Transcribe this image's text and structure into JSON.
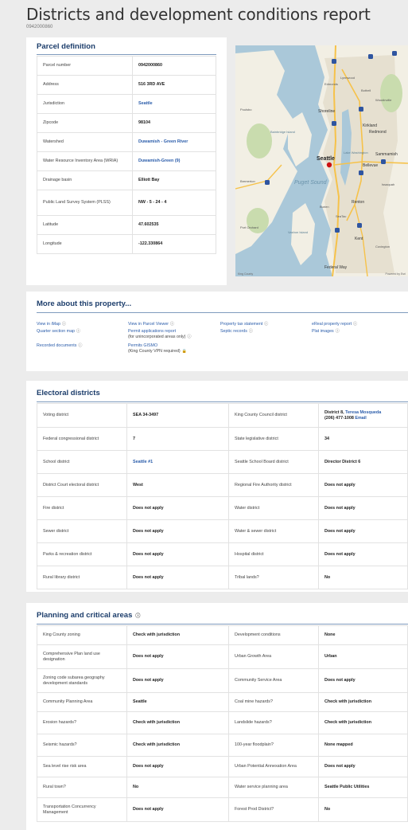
{
  "page": {
    "title": "Districts and development conditions report",
    "parcel_id": "0942000860"
  },
  "parcel": {
    "heading": "Parcel definition",
    "rows": [
      {
        "label": "Parcel number",
        "value": "0942000860",
        "label_link": false,
        "value_link": false
      },
      {
        "label": "Address",
        "value": "516 3RD AVE",
        "label_link": false,
        "value_link": false
      },
      {
        "label": "Jurisdiction",
        "value": "Seattle",
        "label_link": false,
        "value_link": true
      },
      {
        "label": "Zipcode",
        "value": "98104",
        "label_link": false,
        "value_link": false
      },
      {
        "label": "Watershed",
        "value": "Duwamish - Green River",
        "label_link": true,
        "value_link": true
      },
      {
        "label": "Water Resource Inventory Area (WRIA)",
        "value": "Duwamish-Green (9)",
        "label_link": true,
        "value_link": true
      },
      {
        "label": "Drainage basin",
        "value": "Elliott Bay",
        "label_link": false,
        "value_link": false
      },
      {
        "label": "Public Land Survey System (PLSS)",
        "value": "NW - 5 - 24 - 4",
        "label_link": false,
        "value_link": false
      },
      {
        "label": "Latitude",
        "value": "47.602535",
        "label_link": false,
        "value_link": false
      },
      {
        "label": "Longitude",
        "value": "-122.330864",
        "label_link": false,
        "value_link": false
      }
    ]
  },
  "map": {
    "labels": {
      "lynnwood": "Lynnwood",
      "edmonds": "Edmonds",
      "bothell": "Bothell",
      "woodinville": "Woodinville",
      "shoreline": "Shoreline",
      "kirkland": "Kirkland",
      "redmond": "Redmond",
      "bainbridge": "Bainbridge Island",
      "seattle": "Seattle",
      "lake_washington": "Lake Washington",
      "bellevue": "Bellevue",
      "sammamish": "Sammamish",
      "bremerton": "Bremerton",
      "puget_sound": "Puget Sound",
      "issaquah": "Issaquah",
      "burien": "Burien",
      "renton": "Renton",
      "seatac": "SeaTac",
      "vashon": "Vashon Island",
      "kent": "Kent",
      "covington": "Covington",
      "federal_way": "Federal Way",
      "poulsbo": "Poulsbo",
      "port_orchard": "Port Orchard",
      "attribution_left": "King County",
      "attribution_right": "Powered by Esri"
    },
    "colors": {
      "water": "#aac8d9",
      "land": "#f2efe4",
      "urban": "#e6e0d0",
      "green": "#c9dcae",
      "road": "#f6c24a",
      "shield": "#2f55a0",
      "marker": "#cc1111"
    }
  },
  "more": {
    "heading": "More about this property...",
    "items": [
      {
        "label": "View in iMap",
        "sub": ""
      },
      {
        "label": "Quarter section map",
        "sub": ""
      },
      {
        "label": "Recorded documents",
        "sub": ""
      },
      {
        "label": "View in Parcel Viewer",
        "sub": ""
      },
      {
        "label": "Permit applications report",
        "sub": "(for unincorporated areas only)"
      },
      {
        "label": "Permits GISMO",
        "sub": "(King County VPN required)"
      },
      {
        "label": "Property tax statement",
        "sub": ""
      },
      {
        "label": "Septic records",
        "sub": ""
      },
      {
        "label": "eReal property report",
        "sub": ""
      },
      {
        "label": "Plat images",
        "sub": ""
      }
    ]
  },
  "electoral": {
    "heading": "Electoral districts",
    "rows": [
      {
        "l1": "Voting district",
        "v1": "SEA 34-3497",
        "l2": "King County Council district",
        "v2": "District 8,",
        "v2_person": "Teresa Mosqueda",
        "v2_phone": "(206) 477-1008",
        "v2_email": "Email"
      },
      {
        "l1": "Federal congressional district",
        "v1": "7",
        "l2": "State legislative district",
        "v2": "34"
      },
      {
        "l1": "School district",
        "v1": "Seattle #1",
        "l2": "Seattle School Board district",
        "v2": "Director District 6"
      },
      {
        "l1": "District Court electoral district",
        "v1": "West",
        "l2": "Regional Fire Authority district",
        "v2": "Does not apply"
      },
      {
        "l1": "Fire district",
        "v1": "Does not apply",
        "l2": "Water district",
        "v2": "Does not apply"
      },
      {
        "l1": "Sewer district",
        "v1": "Does not apply",
        "l2": "Water & sewer district",
        "v2": "Does not apply"
      },
      {
        "l1": "Parks & recreation district",
        "v1": "Does not apply",
        "l2": "Hospital district",
        "v2": "Does not apply"
      },
      {
        "l1": "Rural library district",
        "v1": "Does not apply",
        "l2": "Tribal lands?",
        "v2": "No"
      }
    ]
  },
  "planning": {
    "heading": "Planning and critical areas",
    "rows": [
      {
        "l1": "King County zoning",
        "v1": "Check with jurisdiction",
        "l2": "Development conditions",
        "v2": "None"
      },
      {
        "l1": "Comprehensive Plan land use designation",
        "v1": "Does not apply",
        "l2": "Urban Growth Area",
        "v2": "Urban"
      },
      {
        "l1": "Zoning code subarea geography development standards",
        "v1": "Does not apply",
        "l2": "Community Service Area",
        "v2": "Does not apply"
      },
      {
        "l1": "Community Planning Area",
        "v1": "Seattle",
        "l2": "Coal mine hazards?",
        "v2": "Check with jurisdiction"
      },
      {
        "l1": "Erosion hazards?",
        "v1": "Check with jurisdiction",
        "l2": "Landslide hazards?",
        "v2": "Check with jurisdiction"
      },
      {
        "l1": "Seismic hazards?",
        "v1": "Check with jurisdiction",
        "l2": "100-year floodplain?",
        "v2": "None mapped"
      },
      {
        "l1": "Sea level rise risk area",
        "v1": "Does not apply",
        "l2": "Urban Potential Annexation Area",
        "v2": "Does not apply"
      },
      {
        "l1": "Rural town?",
        "v1": "No",
        "l2": "Water service planning area",
        "v2": "Seattle Public Utilities"
      },
      {
        "l1": "Transportation Concurrency Management",
        "v1": "Does not apply",
        "l2": "Forest Prod District?",
        "v2": "No"
      }
    ]
  }
}
